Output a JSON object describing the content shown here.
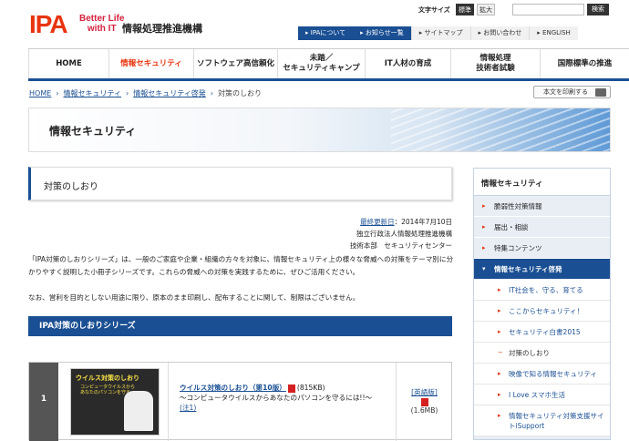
{
  "header": {
    "logo": "IPA",
    "slogan": "Better Life\nwith IT",
    "org_name": "情報処理推進機構",
    "font_size_label": "文字サイズ",
    "font_standard": "標準",
    "font_large": "拡大",
    "search_placeholder": "",
    "search_button": "検索",
    "subnav": [
      "IPAについて",
      "お知らせ一覧",
      "サイトマップ",
      "お問い合わせ",
      "ENGLISH"
    ]
  },
  "global_nav": [
    "HOME",
    "情報セキュリティ",
    "ソフトウェア高信頼化",
    "未踏／\nセキュリティキャンプ",
    "IT人材の育成",
    "情報処理\n技術者試験",
    "国際標準の推進"
  ],
  "breadcrumb": [
    "HOME",
    "情報セキュリティ",
    "情報セキュリティ啓発",
    "対策のしおり"
  ],
  "print_button": "本文を印刷する",
  "banner_title": "情報セキュリティ",
  "page_title": "対策のしおり",
  "meta": {
    "updated_label": "最終更新日",
    "updated_date": "：2014年7月10日",
    "org": "独立行政法人情報処理推進機構",
    "dept": "技術本部　セキュリティセンター"
  },
  "body": {
    "p1": "「IPA対策のしおりシリーズ」は、一般のご家庭や企業・組織の方々を対象に、情報セキュリティ上の様々な脅威への対策をテーマ別に分かりやすく説明した小冊子シリーズです。これらの脅威への対策を実践するために、ぜひご活用ください。",
    "p2": "なお、営利を目的としない用途に限り、原本のまま印刷し、配布することに関して、制限はございません。"
  },
  "section_title": "IPA対策のしおりシリーズ",
  "table_row": {
    "num": "1",
    "thumb_title": "ウイルス対策のしおり",
    "thumb_sub": "コンピュータウイルスから\nあなたのパソコンを守る",
    "title": "ウイルス対策のしおり（第10版）",
    "size": "(815KB)",
    "desc": "～コンピュータウイルスからあなたのパソコンを守るには!!～",
    "note": "(注1)",
    "eng_label": "[英語版]",
    "eng_size": "(1.6MB)"
  },
  "sidebar": {
    "heading": "情報セキュリティ",
    "items": [
      "脆弱性対策情報",
      "届出・相談",
      "特集コンテンツ",
      "情報セキュリティ啓発"
    ],
    "subitems": [
      "IT社会を、守る、育てる",
      "ここからセキュリティ！",
      "セキュリティ白書2015",
      "対策のしおり",
      "映像で知る情報セキュリティ",
      "I Love スマホ生活",
      "情報セキュリティ対策支援サイトiSupport"
    ]
  },
  "colors": {
    "brand_red": "#e8340f",
    "brand_blue": "#1a4f93"
  }
}
